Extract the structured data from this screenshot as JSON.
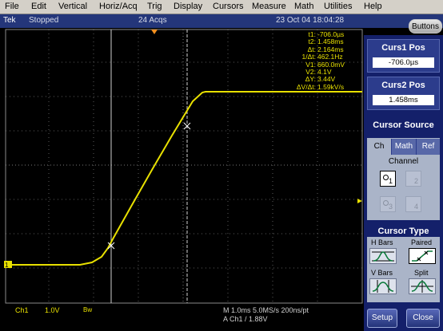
{
  "menu": {
    "items": [
      "File",
      "Edit",
      "Vertical",
      "Horiz/Acq",
      "Trig",
      "Display",
      "Cursors",
      "Measure",
      "Math",
      "Utilities",
      "Help"
    ]
  },
  "status": {
    "brand": "Tek",
    "state": "Stopped",
    "acqs": "24 Acqs",
    "datetime": "23 Oct 04 18:04:28",
    "buttons_label": "Buttons"
  },
  "readout": [
    {
      "label": "t1:",
      "value": "-706.0µs"
    },
    {
      "label": "t2:",
      "value": "1.458ms"
    },
    {
      "label": "Δt:",
      "value": "2.164ms"
    },
    {
      "label": "1/Δt:",
      "value": "462.1Hz"
    },
    {
      "label": "V1:",
      "value": "660.0mV"
    },
    {
      "label": "V2:",
      "value": "4.1V"
    },
    {
      "label": "ΔY:",
      "value": "3.44V"
    },
    {
      "label": "ΔV/Δt:",
      "value": "1.59kV/s"
    }
  ],
  "bottom": {
    "ch_name": "Ch1",
    "ch_scale": "1.0V",
    "bw": "Bw",
    "horiz": "M 1.0ms 5.0MS/s  200ns/pt",
    "trigger": "A  Ch1  /  1.88V"
  },
  "side": {
    "curs1": {
      "title": "Curs1 Pos",
      "value": "-706.0µs"
    },
    "curs2": {
      "title": "Curs2 Pos",
      "value": "1.458ms"
    },
    "cursor_source": {
      "title": "Cursor Source",
      "tabs": [
        "Ch",
        "Math",
        "Ref"
      ],
      "selected_tab": "Ch",
      "channel_label": "Channel",
      "channels": [
        "1",
        "2",
        "3",
        "4"
      ],
      "selected_channel": "1"
    },
    "cursor_type": {
      "title": "Cursor Type",
      "types": [
        "H Bars",
        "Paired",
        "V Bars",
        "Split"
      ],
      "selected": "Paired"
    },
    "setup_label": "Setup",
    "close_label": "Close"
  },
  "colors": {
    "trace": "#e8e000",
    "panel": "#14206a",
    "status_bar": "#24367a",
    "menu_bg": "#d4d0c8"
  },
  "icons": {
    "trigger_marker": "trigger-position-arrow-icon",
    "ground_marker": "channel1-ground-marker-icon",
    "trigger_level": "trigger-level-arrow-icon"
  }
}
